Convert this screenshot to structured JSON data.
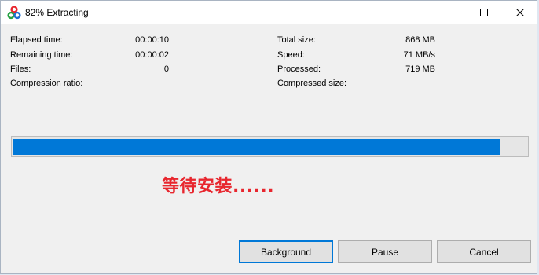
{
  "window": {
    "title": "82% Extracting"
  },
  "icons": {
    "app": "7zip-app-icon",
    "minimize": "minimize-icon",
    "maximize": "maximize-icon",
    "close": "close-icon"
  },
  "stats": {
    "elapsed_label": "Elapsed time:",
    "elapsed_value": "00:00:10",
    "remaining_label": "Remaining time:",
    "remaining_value": "00:00:02",
    "files_label": "Files:",
    "files_value": "0",
    "compression_ratio_label": "Compression ratio:",
    "total_size_label": "Total size:",
    "total_size_value": "868 MB",
    "speed_label": "Speed:",
    "speed_value": "71 MB/s",
    "processed_label": "Processed:",
    "processed_value": "719 MB",
    "compressed_size_label": "Compressed size:"
  },
  "progress": {
    "fraction": 0.948,
    "fill_color": "#0078d7"
  },
  "overlay": {
    "text": "等待安装......",
    "color": "#e8262e"
  },
  "buttons": {
    "background": "Background",
    "pause": "Pause",
    "cancel": "Cancel"
  }
}
